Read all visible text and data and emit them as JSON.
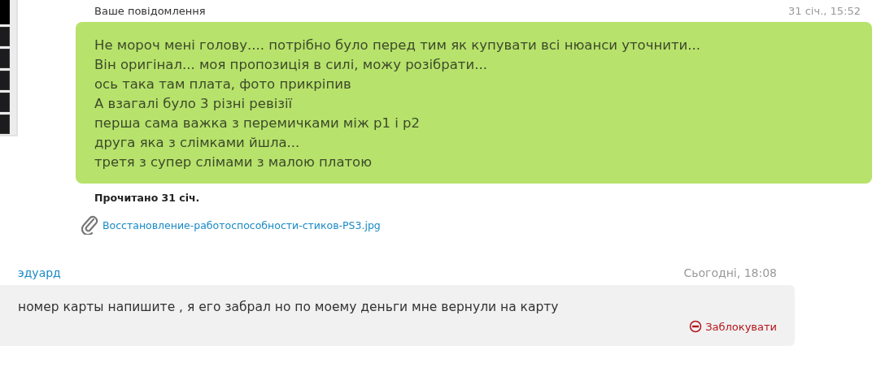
{
  "own_message": {
    "label": "Ваше повідомлення",
    "time": "31 січ., 15:52",
    "lines": [
      "Не мороч мені голову.... потрібно було перед тим як купувати всі нюанси уточнити...",
      "Він оригінал... моя пропозиція в силі, можу розібрати...",
      "ось така там плата, фото прикріпив",
      "А взагалі було 3 різні ревізії",
      "перша сама важка з перемичками між p1 і p2",
      "друга яка з слімками йшла...",
      "третя з супер слімами з малою платою"
    ],
    "read_status": "Прочитано 31 січ.",
    "attachment": "Восстановление-работоспособности-стиков-PS3.jpg"
  },
  "received_message": {
    "sender": "эдуард",
    "time": "Сьогодні, 18:08",
    "text": "номер карты напишите , я его забрал но по моему деньги мне вернули на карту",
    "block_link": "Заблокувати"
  }
}
